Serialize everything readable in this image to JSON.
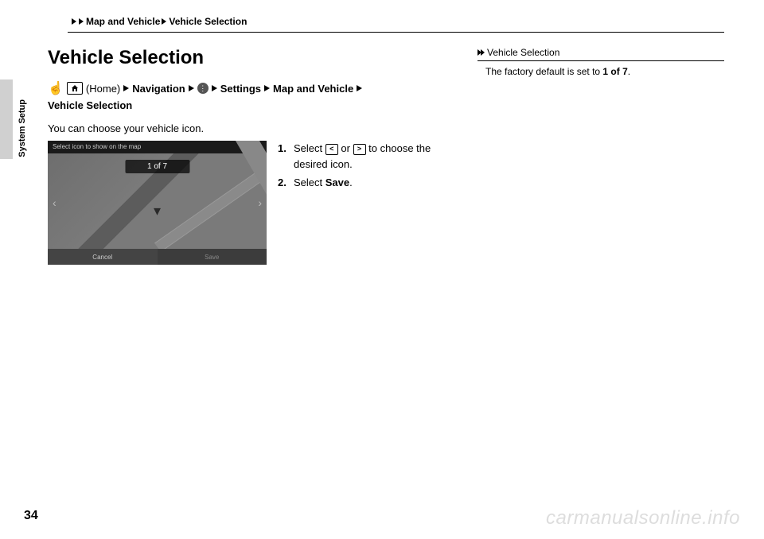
{
  "breadcrumb": {
    "level1": "Map and Vehicle",
    "level2": "Vehicle Selection"
  },
  "side_tab": "System Setup",
  "title": "Vehicle Selection",
  "path": {
    "home_text": "(Home)",
    "nav": "Navigation",
    "settings": "Settings",
    "map_vehicle": "Map and Vehicle",
    "vehicle_selection": "Vehicle Selection"
  },
  "description": "You can choose your vehicle icon.",
  "screenshot": {
    "topbar": "Select icon to show on the map",
    "counter": "1 of 7",
    "cancel": "Cancel",
    "save": "Save"
  },
  "instructions": {
    "step1_num": "1.",
    "step1_a": "Select ",
    "step1_or": " or ",
    "step1_b": " to choose the desired icon.",
    "step2_num": "2.",
    "step2_a": "Select ",
    "step2_b": "Save",
    "step2_c": "."
  },
  "sidebar": {
    "header": "Vehicle Selection",
    "body_a": "The factory default is set to ",
    "body_b": "1 of 7",
    "body_c": "."
  },
  "page_number": "34",
  "watermark": "carmanualsonline.info"
}
